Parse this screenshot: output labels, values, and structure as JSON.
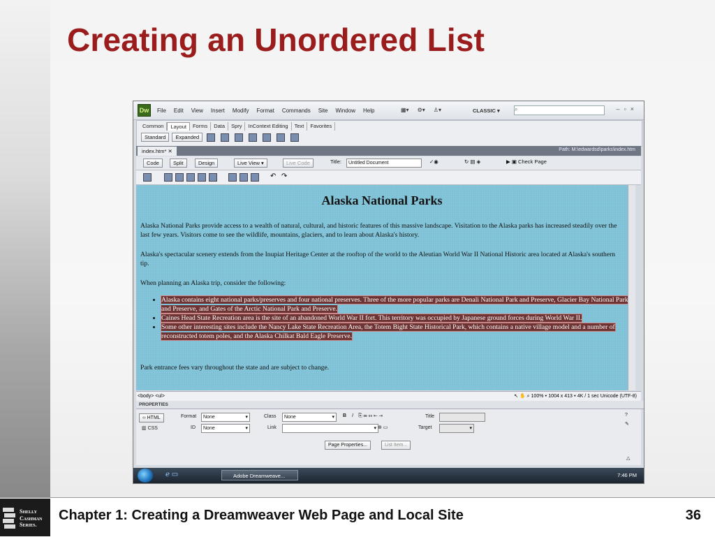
{
  "slide": {
    "title": "Creating an Unordered List",
    "footer_text": "Chapter 1: Creating a Dreamweaver Web Page and Local Site",
    "page_number": "36",
    "logo_lines": [
      "Shelly",
      "Cashman",
      "Series."
    ]
  },
  "app": {
    "logo": "Dw",
    "menus": [
      "File",
      "Edit",
      "View",
      "Insert",
      "Modify",
      "Format",
      "Commands",
      "Site",
      "Window",
      "Help"
    ],
    "workspace": "CLASSIC",
    "insert_tabs": [
      "Common",
      "Layout",
      "Forms",
      "Data",
      "Spry",
      "InContext Editing",
      "Text",
      "Favorites"
    ],
    "insert_active": "Layout",
    "mode_buttons": [
      "Standard",
      "Expanded"
    ],
    "doc_tab": "index.htm*",
    "doc_path": "Path: M:\\edwardsd\\parks\\index.htm",
    "view_buttons": [
      "Code",
      "Split",
      "Design"
    ],
    "live_view": "Live View",
    "live_code": "Live Code",
    "title_label": "Title:",
    "doc_title": "Untitled Document",
    "check_page": "Check Page"
  },
  "page": {
    "heading": "Alaska National Parks",
    "p1": "Alaska National Parks provide access to a wealth of natural, cultural, and historic features of this massive landscape. Visitation to the Alaska parks has increased steadily over the last few years. Visitors come to see the wildlife, mountains, glaciers, and to learn about Alaska's history.",
    "p2": "Alaska's spectacular scenery extends from the Inupiat Heritage Center at the rooftop of the world to the Aleutian World War II National Historic area located at Alaska's southern tip.",
    "p3": "When planning an Alaska trip, consider the following:",
    "list": [
      "Alaska contains eight national parks/preserves and four national preserves. Three of the more popular parks are Denali National Park and Preserve, Glacier Bay National Park and Preserve, and Gates of the Arctic National Park and Preserve.",
      "Caines Head State Recreation area is the site of an abandoned World War II fort. This territory was occupied by Japanese ground forces during World War II.",
      "Some other interesting sites include the Nancy Lake State Recreation Area, the Totem Bight State Historical Park, which contains a native village model and a number of reconstructed totem poles, and the Alaska Chilkat Bald Eagle Preserve."
    ],
    "p4": "Park entrance fees vary throughout the state and are subject to change."
  },
  "status": {
    "tag_selector": "<body> <ul>",
    "zoom": "100%",
    "size": "1004 x 413",
    "download": "4K / 1 sec",
    "encoding": "Unicode (UTF-8)"
  },
  "properties": {
    "header": "PROPERTIES",
    "html_btn": "HTML",
    "css_btn": "CSS",
    "format_label": "Format",
    "format_value": "None",
    "id_label": "ID",
    "id_value": "None",
    "class_label": "Class",
    "class_value": "None",
    "link_label": "Link",
    "title_label": "Title",
    "target_label": "Target",
    "page_properties": "Page Properties...",
    "list_item": "List Item..."
  },
  "taskbar": {
    "app_button": "Adobe Dreamweave...",
    "clock": "7:46 PM"
  }
}
